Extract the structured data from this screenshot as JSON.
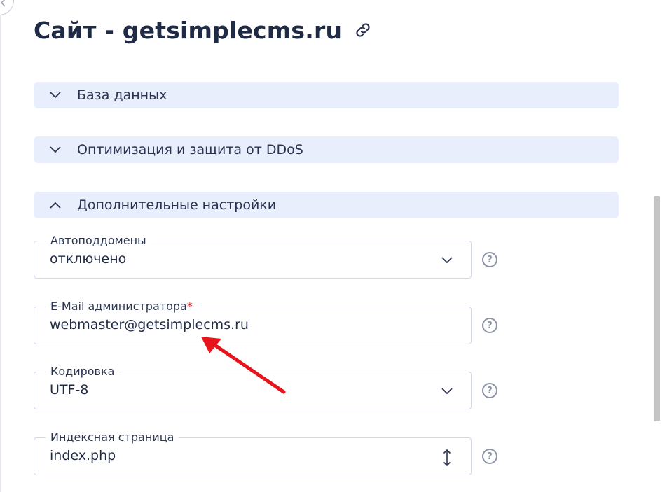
{
  "page": {
    "title": "Сайт - getsimplecms.ru"
  },
  "sections": [
    {
      "label": "База данных",
      "state": "collapsed"
    },
    {
      "label": "Оптимизация и защита от DDoS",
      "state": "collapsed"
    },
    {
      "label": "Дополнительные настройки",
      "state": "expanded"
    }
  ],
  "fields": {
    "autosubdomains": {
      "label": "Автоподдомены",
      "value": "отключено",
      "control": "select"
    },
    "admin_email": {
      "label": "E-Mail администратора",
      "required_mark": "*",
      "value": "webmaster@getsimplecms.ru",
      "control": "text"
    },
    "encoding": {
      "label": "Кодировка",
      "value": "UTF-8",
      "control": "select"
    },
    "index_page": {
      "label": "Индексная страница",
      "value": "index.php",
      "control": "sortable-select"
    }
  },
  "help": {
    "symbol": "?"
  },
  "colors": {
    "title": "#1f2a44",
    "section_bg": "#e8eefb",
    "required": "#d62828",
    "annotation_arrow": "#e8141c",
    "border": "#d3d8e2"
  }
}
